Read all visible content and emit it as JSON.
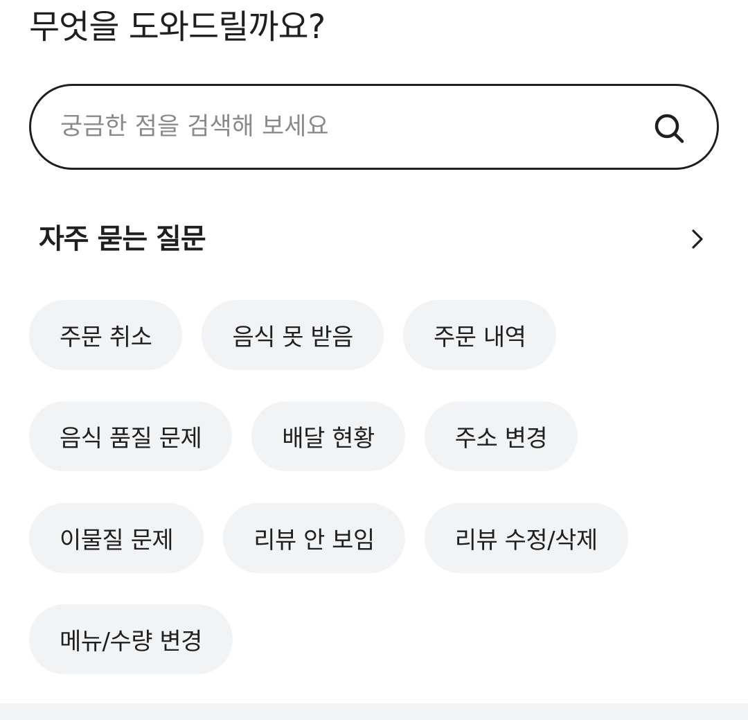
{
  "page": {
    "title": "무엇을 도와드릴까요?"
  },
  "search": {
    "placeholder": "궁금한 점을 검색해 보세요",
    "value": "",
    "icon": "search-icon"
  },
  "faq": {
    "title": "자주 묻는 질문",
    "more_icon": "chevron-right-icon",
    "rows": [
      [
        "주문 취소",
        "음식 못 받음",
        "주문 내역"
      ],
      [
        "음식 품질 문제",
        "배달 현황",
        "주소 변경"
      ],
      [
        "이물질 문제",
        "리뷰 안 보임",
        "리뷰 수정/삭제"
      ],
      [
        "메뉴/수량 변경"
      ]
    ]
  },
  "colors": {
    "text": "#1f1f1f",
    "placeholder": "#8a8a8a",
    "chip_background": "#f2f3f5",
    "border": "#1f1f1f",
    "background": "#ffffff"
  }
}
